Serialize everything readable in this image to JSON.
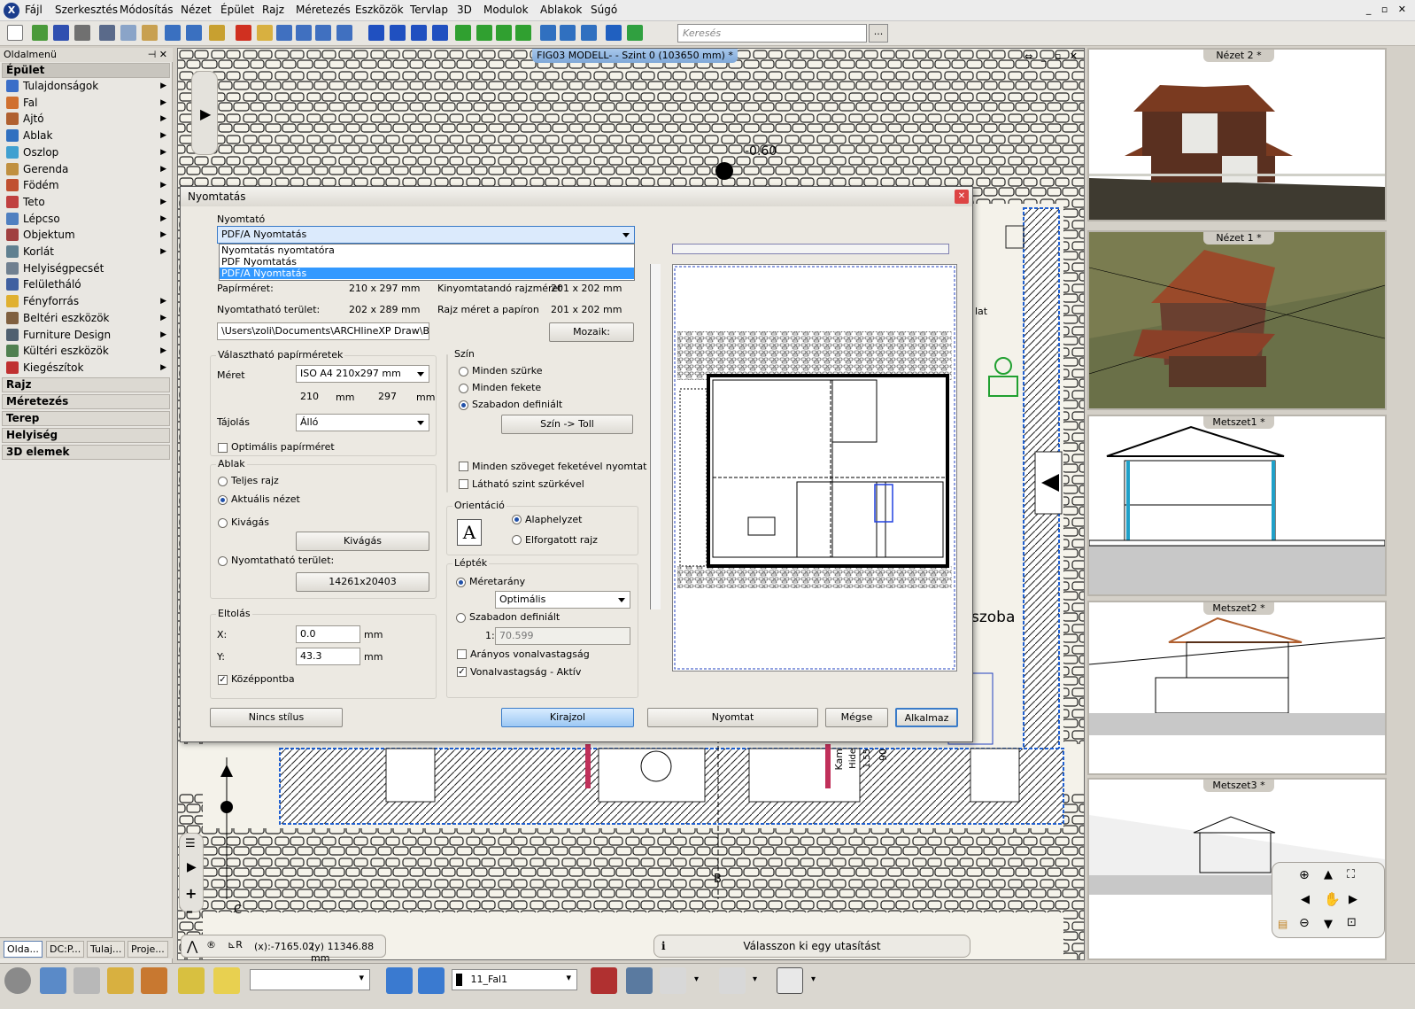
{
  "menu": {
    "logo": "X",
    "items": [
      "Fájl",
      "Szerkesztés",
      "Módosítás",
      "Nézet",
      "Épület",
      "Rajz",
      "Méretezés",
      "Eszközök",
      "Tervlap",
      "3D",
      "Modulok",
      "Ablakok",
      "Súgó"
    ],
    "window_controls": "_ ▫ ✕"
  },
  "toolbar": {
    "search_placeholder": "Keresés",
    "search_button": "..."
  },
  "sidebar": {
    "title": "Oldalmenü",
    "title_controls": "⊣ ✕",
    "active_section": "Épület",
    "items": [
      {
        "label": "Tulajdonságok",
        "icon": "properties-icon",
        "color": "#3a6ec8"
      },
      {
        "label": "Fal",
        "icon": "wall-icon",
        "color": "#d07030"
      },
      {
        "label": "Ajtó",
        "icon": "door-icon",
        "color": "#b06030"
      },
      {
        "label": "Ablak",
        "icon": "window-icon",
        "color": "#3070c0"
      },
      {
        "label": "Oszlop",
        "icon": "column-icon",
        "color": "#40a0d0"
      },
      {
        "label": "Gerenda",
        "icon": "beam-icon",
        "color": "#c09040"
      },
      {
        "label": "Födém",
        "icon": "slab-icon",
        "color": "#c05030"
      },
      {
        "label": "Teto",
        "icon": "roof-icon",
        "color": "#c04040"
      },
      {
        "label": "Lépcso",
        "icon": "stairs-icon",
        "color": "#5080c0"
      },
      {
        "label": "Objektum",
        "icon": "object-icon",
        "color": "#a04040"
      },
      {
        "label": "Korlát",
        "icon": "railing-icon",
        "color": "#608090"
      },
      {
        "label": "Helyiségpecsét",
        "icon": "room-stamp-icon",
        "color": "#708090"
      },
      {
        "label": "Felületháló",
        "icon": "surface-mesh-icon",
        "color": "#4060a0"
      },
      {
        "label": "Fényforrás",
        "icon": "light-icon",
        "color": "#e0b030"
      },
      {
        "label": "Beltéri eszközök",
        "icon": "interior-icon",
        "color": "#806040"
      },
      {
        "label": "Furniture Design",
        "icon": "furniture-icon",
        "color": "#506070"
      },
      {
        "label": "Kültéri eszközök",
        "icon": "exterior-icon",
        "color": "#508050"
      },
      {
        "label": "Kiegészítok",
        "icon": "addons-icon",
        "color": "#c03030"
      }
    ],
    "sections": [
      "Rajz",
      "Méretezés",
      "Terep",
      "Helyiség",
      "3D elemek"
    ],
    "tabs": [
      "Olda...",
      "DC:P...",
      "Tulaj...",
      "Proje..."
    ]
  },
  "drawing": {
    "title": "FIG03 MODELL- - Szint 0 (103650 mm) *",
    "controls": "⇔ _ ▫ ✕",
    "labels": {
      "level": "-0.60",
      "room": "szoba",
      "lat": "lat",
      "section_b": "B",
      "section_c": "C",
      "kam": "Kam",
      "hide": "Hide",
      "num1": "1.55",
      "num2": "90"
    },
    "coords": {
      "x": "(x):-7165.02",
      "y": "(y) 11346.88 mm"
    },
    "status": "Válasszon ki egy utasítást"
  },
  "views": [
    {
      "title": "Nézet 2 *"
    },
    {
      "title": "Nézet 1 *"
    },
    {
      "title": "Metszet1 *"
    },
    {
      "title": "Metszet2 *"
    },
    {
      "title": "Metszet3 *"
    }
  ],
  "bottom": {
    "layer": "11_Fal1"
  },
  "dialog": {
    "title": "Nyomtatás",
    "printer_label": "Nyomtató",
    "printer_selected": "PDF/A Nyomtatás",
    "printer_options": [
      "Nyomtatás nyomtatóra",
      "PDF Nyomtatás",
      "PDF/A Nyomtatás"
    ],
    "paper_size_label": "Papírméret:",
    "paper_size_value": "210 x 297 mm",
    "printed_size_label": "Kinyomtatandó rajzméret",
    "printed_size_value": "201 x 202 mm",
    "printable_area_label": "Nyomtatható terület:",
    "printable_area_value": "202 x 289 mm",
    "drawing_size_label": "Rajz méret a papíron",
    "drawing_size_value": "201 x 202 mm",
    "path": "\\Users\\zoli\\Documents\\ARCHlineXP Draw\\Bloch.p",
    "mosaic_button": "Mozaik:",
    "paper_group": "Választható papírméretek",
    "size_label": "Méret",
    "size_value": "ISO A4 210x297 mm",
    "width_value": "210",
    "height_value": "297",
    "mm": "mm",
    "orientation_label": "Tájolás",
    "orientation_value": "Álló",
    "optimal_paper": "Optimális papírméret",
    "window_group": "Ablak",
    "full_drawing": "Teljes rajz",
    "current_view": "Aktuális nézet",
    "cutout": "Kivágás",
    "cutout_button": "Kivágás",
    "printable_area_radio": "Nyomtatható terület:",
    "area_button": "14261x20403",
    "offset_group": "Eltolás",
    "x_label": "X:",
    "x_value": "0.0",
    "y_label": "Y:",
    "y_value": "43.3",
    "center": "Középpontba",
    "color_group": "Szín",
    "all_gray": "Minden szürke",
    "all_black": "Minden fekete",
    "free_defined": "Szabadon definiált",
    "color_pen_button": "Szín -> Toll",
    "all_text_black": "Minden szöveget feketével nyomtat",
    "visible_level_gray": "Látható szint szürkével",
    "orientation_group": "Orientáció",
    "default_pos": "Alaphelyzet",
    "rotated": "Elforgatott rajz",
    "orient_icon": "A",
    "scale_group": "Lépték",
    "scale_ratio": "Méretarány",
    "scale_value": "Optimális",
    "scale_free": "Szabadon definiált",
    "scale_prefix": "1:",
    "scale_free_value": "70.599",
    "prop_line": "Arányos vonalvastagság",
    "line_active": "Vonalvastagság - Aktív",
    "btn_no_style": "Nincs stílus",
    "btn_draw": "Kirajzol",
    "btn_print": "Nyomtat",
    "btn_cancel": "Mégse",
    "btn_apply": "Alkalmaz"
  }
}
